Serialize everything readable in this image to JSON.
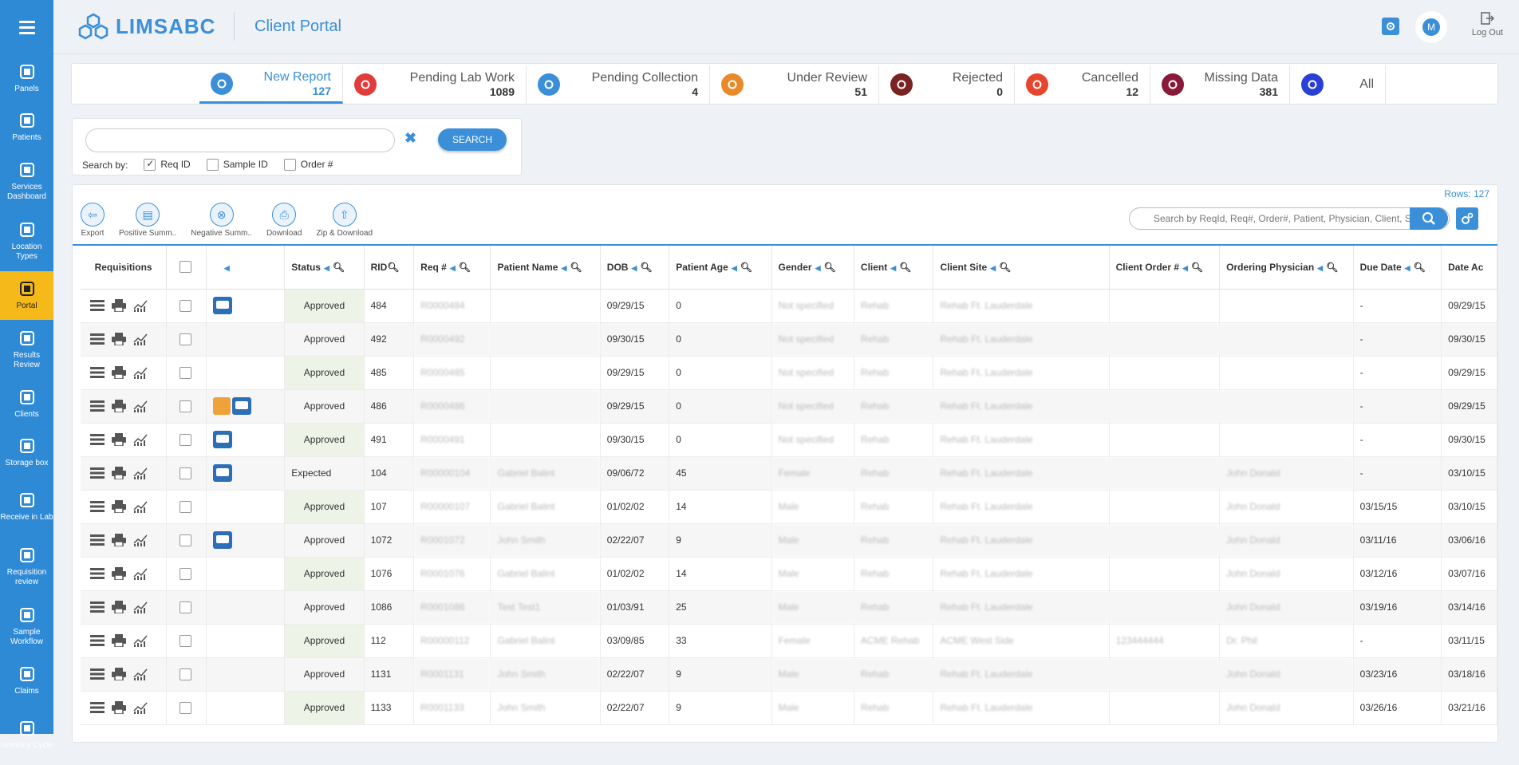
{
  "app": {
    "logo": "LIMSABC",
    "title": "Client Portal",
    "user_initial": "M",
    "logout_label": "Log Out"
  },
  "sidebar": {
    "items": [
      {
        "label": "Panels",
        "icon": "panels-icon"
      },
      {
        "label": "Patients",
        "icon": "patients-icon"
      },
      {
        "label": "Services Dashboard",
        "icon": "services-icon"
      },
      {
        "label": "Location Types",
        "icon": "location-icon"
      },
      {
        "label": "Portal",
        "icon": "portal-icon",
        "active": true
      },
      {
        "label": "Results Review",
        "icon": "results-icon"
      },
      {
        "label": "Clients",
        "icon": "clients-icon"
      },
      {
        "label": "Storage box",
        "icon": "storage-icon"
      },
      {
        "label": "Receive in Lab",
        "icon": "receive-icon"
      },
      {
        "label": "Requisition review",
        "icon": "requisition-icon"
      },
      {
        "label": "Sample Workflow",
        "icon": "workflow-icon"
      },
      {
        "label": "Claims",
        "icon": "claims-icon"
      },
      {
        "label": "nventory Cycle",
        "icon": "inventory-icon"
      }
    ]
  },
  "tabs": [
    {
      "label": "New Report",
      "count": "127",
      "color": "#3a8fd8",
      "icon": "report-icon"
    },
    {
      "label": "Pending Lab Work",
      "count": "1089",
      "color": "#e23b3b",
      "icon": "lab-icon"
    },
    {
      "label": "Pending Collection",
      "count": "4",
      "color": "#3a8fd8",
      "icon": "hourglass-icon"
    },
    {
      "label": "Under Review",
      "count": "51",
      "color": "#e98a2a",
      "icon": "review-icon"
    },
    {
      "label": "Rejected",
      "count": "0",
      "color": "#7a2323",
      "icon": "rejected-icon"
    },
    {
      "label": "Cancelled",
      "count": "12",
      "color": "#e8452f",
      "icon": "cancelled-icon"
    },
    {
      "label": "Missing Data",
      "count": "381",
      "color": "#8a1a3a",
      "icon": "missing-icon"
    },
    {
      "label": "All",
      "count": "",
      "color": "#2a3fd6",
      "icon": "all-icon"
    }
  ],
  "search": {
    "value": "",
    "clear": "✖",
    "button": "SEARCH",
    "by_label": "Search by:",
    "options": [
      {
        "label": "Req ID",
        "checked": true
      },
      {
        "label": "Sample ID",
        "checked": false
      },
      {
        "label": "Order #",
        "checked": false
      }
    ]
  },
  "grid": {
    "rows_label": "Rows: 127",
    "search_placeholder": "Search by ReqId, Req#, Order#, Patient, Physician, Client, Site",
    "toolbar": [
      {
        "label": "Export"
      },
      {
        "label": "Positive Summ.."
      },
      {
        "label": "Negative Summ.."
      },
      {
        "label": "Download"
      },
      {
        "label": "Zip & Download"
      }
    ],
    "columns": [
      "Requisitions",
      "",
      "",
      "Status",
      "RID",
      "Req #",
      "Patient Name",
      "DOB",
      "Patient Age",
      "Gender",
      "Client",
      "Client Site",
      "Client Order #",
      "Ordering Physician",
      "Due Date",
      "Date Ac"
    ],
    "rows": [
      {
        "status": "Approved",
        "rid": "484",
        "req": "R0000484",
        "name": "",
        "dob": "09/29/15",
        "age": "0",
        "gender": "Not specified",
        "client": "Rehab",
        "site": "Rehab Ft. Lauderdale",
        "order": "",
        "physician": "",
        "due": "-",
        "date": "09/29/15",
        "chat": true,
        "badge": false
      },
      {
        "status": "Approved",
        "rid": "492",
        "req": "R0000492",
        "name": "",
        "dob": "09/30/15",
        "age": "0",
        "gender": "Not specified",
        "client": "Rehab",
        "site": "Rehab Ft. Lauderdale",
        "order": "",
        "physician": "",
        "due": "-",
        "date": "09/30/15",
        "chat": false,
        "badge": false
      },
      {
        "status": "Approved",
        "rid": "485",
        "req": "R0000485",
        "name": "",
        "dob": "09/29/15",
        "age": "0",
        "gender": "Not specified",
        "client": "Rehab",
        "site": "Rehab Ft. Lauderdale",
        "order": "",
        "physician": "",
        "due": "-",
        "date": "09/29/15",
        "chat": false,
        "badge": false
      },
      {
        "status": "Approved",
        "rid": "486",
        "req": "R0000486",
        "name": "",
        "dob": "09/29/15",
        "age": "0",
        "gender": "Not specified",
        "client": "Rehab",
        "site": "Rehab Ft. Lauderdale",
        "order": "",
        "physician": "",
        "due": "-",
        "date": "09/29/15",
        "chat": true,
        "badge": true
      },
      {
        "status": "Approved",
        "rid": "491",
        "req": "R0000491",
        "name": "",
        "dob": "09/30/15",
        "age": "0",
        "gender": "Not specified",
        "client": "Rehab",
        "site": "Rehab Ft. Lauderdale",
        "order": "",
        "physician": "",
        "due": "-",
        "date": "09/30/15",
        "chat": true,
        "badge": false
      },
      {
        "status": "Expected",
        "rid": "104",
        "req": "R00000104",
        "name": "Gabriel Balint",
        "dob": "09/06/72",
        "age": "45",
        "gender": "Female",
        "client": "Rehab",
        "site": "Rehab Ft. Lauderdale",
        "order": "",
        "physician": "John Donald",
        "due": "-",
        "date": "03/10/15",
        "chat": true,
        "badge": false
      },
      {
        "status": "Approved",
        "rid": "107",
        "req": "R00000107",
        "name": "Gabriel Balint",
        "dob": "01/02/02",
        "age": "14",
        "gender": "Male",
        "client": "Rehab",
        "site": "Rehab Ft. Lauderdale",
        "order": "",
        "physician": "John Donald",
        "due": "03/15/15",
        "date": "03/10/15",
        "chat": false,
        "badge": false
      },
      {
        "status": "Approved",
        "rid": "1072",
        "req": "R0001072",
        "name": "John Smith",
        "dob": "02/22/07",
        "age": "9",
        "gender": "Male",
        "client": "Rehab",
        "site": "Rehab Ft. Lauderdale",
        "order": "",
        "physician": "John Donald",
        "due": "03/11/16",
        "date": "03/06/16",
        "chat": true,
        "badge": false
      },
      {
        "status": "Approved",
        "rid": "1076",
        "req": "R0001076",
        "name": "Gabriel Balint",
        "dob": "01/02/02",
        "age": "14",
        "gender": "Male",
        "client": "Rehab",
        "site": "Rehab Ft. Lauderdale",
        "order": "",
        "physician": "John Donald",
        "due": "03/12/16",
        "date": "03/07/16",
        "chat": false,
        "badge": false
      },
      {
        "status": "Approved",
        "rid": "1086",
        "req": "R0001086",
        "name": "Test Test1",
        "dob": "01/03/91",
        "age": "25",
        "gender": "Male",
        "client": "Rehab",
        "site": "Rehab Ft. Lauderdale",
        "order": "",
        "physician": "John Donald",
        "due": "03/19/16",
        "date": "03/14/16",
        "chat": false,
        "badge": false
      },
      {
        "status": "Approved",
        "rid": "112",
        "req": "R00000112",
        "name": "Gabriel Balint",
        "dob": "03/09/85",
        "age": "33",
        "gender": "Female",
        "client": "ACME Rehab",
        "site": "ACME West Side",
        "order": "123444444",
        "physician": "Dr. Phil",
        "due": "-",
        "date": "03/11/15",
        "chat": false,
        "badge": false
      },
      {
        "status": "Approved",
        "rid": "1131",
        "req": "R0001131",
        "name": "John Smith",
        "dob": "02/22/07",
        "age": "9",
        "gender": "Male",
        "client": "Rehab",
        "site": "Rehab Ft. Lauderdale",
        "order": "",
        "physician": "John Donald",
        "due": "03/23/16",
        "date": "03/18/16",
        "chat": false,
        "badge": false
      },
      {
        "status": "Approved",
        "rid": "1133",
        "req": "R0001133",
        "name": "John Smith",
        "dob": "02/22/07",
        "age": "9",
        "gender": "Male",
        "client": "Rehab",
        "site": "Rehab Ft. Lauderdale",
        "order": "",
        "physician": "John Donald",
        "due": "03/26/16",
        "date": "03/21/16",
        "chat": false,
        "badge": false
      }
    ]
  }
}
